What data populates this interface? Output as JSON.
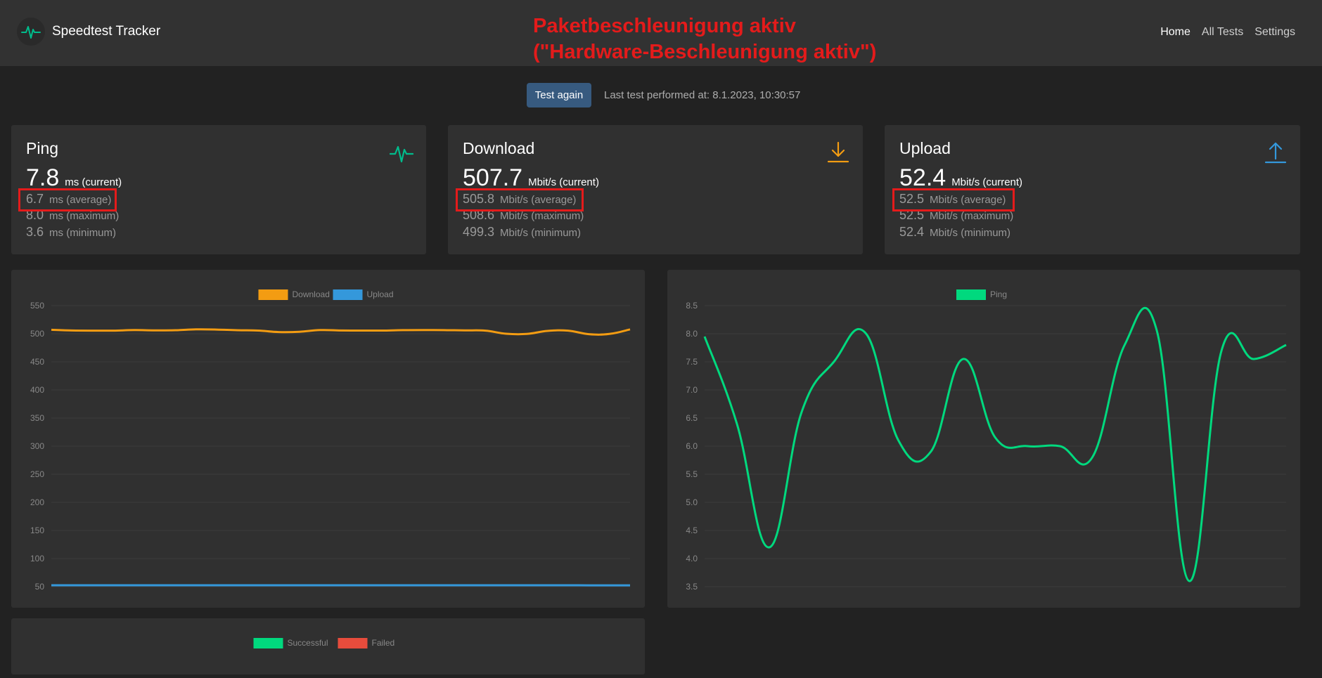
{
  "app": {
    "title": "Speedtest Tracker"
  },
  "nav": [
    {
      "label": "Home",
      "active": true
    },
    {
      "label": "All Tests",
      "active": false
    },
    {
      "label": "Settings",
      "active": false
    }
  ],
  "annotation": {
    "line1": "Paketbeschleunigung aktiv",
    "line2": "(\"Hardware-Beschleunigung aktiv\")",
    "color": "#e41b1b"
  },
  "toolbar": {
    "test_again_label": "Test again",
    "last_test_text": "Last test performed at: 8.1.2023, 10:30:57"
  },
  "cards": {
    "ping": {
      "title": "Ping",
      "current": "7.8",
      "current_unit": "ms (current)",
      "average": "6.7",
      "average_unit": "ms (average)",
      "maximum": "8.0",
      "maximum_unit": "ms (maximum)",
      "minimum": "3.6",
      "minimum_unit": "ms (minimum)",
      "icon": "pulse-icon",
      "color": "#00bc8c"
    },
    "download": {
      "title": "Download",
      "current": "507.7",
      "current_unit": "Mbit/s (current)",
      "average": "505.8",
      "average_unit": "Mbit/s (average)",
      "maximum": "508.6",
      "maximum_unit": "Mbit/s (maximum)",
      "minimum": "499.3",
      "minimum_unit": "Mbit/s (minimum)",
      "icon": "download-icon",
      "color": "#f39c12"
    },
    "upload": {
      "title": "Upload",
      "current": "52.4",
      "current_unit": "Mbit/s (current)",
      "average": "52.5",
      "average_unit": "Mbit/s (average)",
      "maximum": "52.5",
      "maximum_unit": "Mbit/s (maximum)",
      "minimum": "52.4",
      "minimum_unit": "Mbit/s (minimum)",
      "icon": "upload-icon",
      "color": "#3498db"
    }
  },
  "chart_data": [
    {
      "type": "line",
      "legend_position": "top",
      "ylim": [
        50,
        550
      ],
      "yticks": [
        550,
        500,
        450,
        400,
        350,
        300,
        250,
        200,
        150,
        100,
        50
      ],
      "grid": true,
      "series": [
        {
          "name": "Download",
          "color": "#f39c12",
          "values": [
            507,
            505.8,
            505.5,
            505.5,
            506.5,
            506,
            506.2,
            507.8,
            507.4,
            506.2,
            505.6,
            503,
            503.5,
            506.5,
            505.8,
            505.6,
            505.6,
            506.4,
            506.6,
            506.4,
            505.9,
            505.5,
            500,
            499.6,
            505,
            505.5,
            499.3,
            499.6,
            507.7
          ]
        },
        {
          "name": "Upload",
          "color": "#3498db",
          "values": [
            52.5,
            52.5,
            52.5,
            52.5,
            52.5,
            52.5,
            52.5,
            52.5,
            52.5,
            52.5,
            52.5,
            52.5,
            52.5,
            52.5,
            52.5,
            52.5,
            52.5,
            52.5,
            52.5,
            52.5,
            52.5,
            52.5,
            52.5,
            52.5,
            52.5,
            52.5,
            52.4,
            52.4,
            52.4
          ]
        }
      ]
    },
    {
      "type": "line",
      "legend_position": "top",
      "ylim": [
        3.5,
        8.5
      ],
      "yticks": [
        8.5,
        8.0,
        7.5,
        7.0,
        6.5,
        6.0,
        5.5,
        5.0,
        4.5,
        4.0,
        3.5
      ],
      "grid": true,
      "series": [
        {
          "name": "Ping",
          "color": "#00d97e",
          "values": [
            7.95,
            6.4,
            4.2,
            6.6,
            7.5,
            8.0,
            6.1,
            5.9,
            7.55,
            6.15,
            6.0,
            6.0,
            5.8,
            7.8,
            8.05,
            3.6,
            7.7,
            7.55,
            7.8
          ]
        }
      ]
    },
    {
      "type": "bar",
      "legend_position": "top",
      "series": [
        {
          "name": "Successful",
          "color": "#00d97e",
          "values": []
        },
        {
          "name": "Failed",
          "color": "#e74c3c",
          "values": []
        }
      ]
    }
  ]
}
